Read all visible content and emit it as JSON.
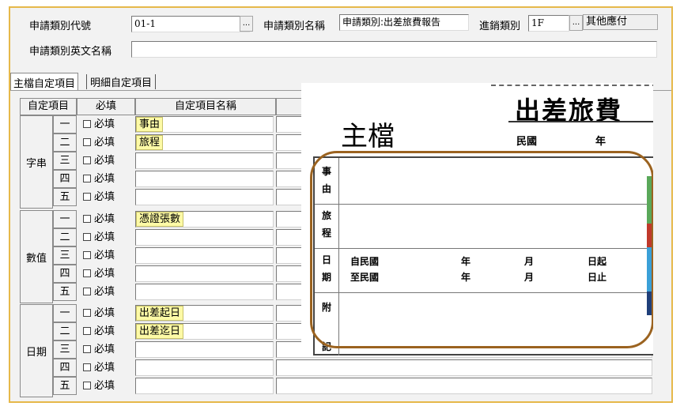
{
  "header": {
    "type_code_label": "申請類別代號",
    "type_code_value": "01-1",
    "ellipsis": "...",
    "type_name_label": "申請類別名稱",
    "type_name_value": "申請類別:出差旅費報告",
    "sales_type_label": "進銷類別",
    "sales_type_value": "1F",
    "sales_type_name": "其他應付",
    "english_name_label": "申請類別英文名稱",
    "english_name_value": ""
  },
  "tabs": [
    {
      "label": "主檔自定項目",
      "active": true
    },
    {
      "label": "明細自定項目",
      "active": false
    }
  ],
  "grid": {
    "headers": [
      "自定項目",
      "必填",
      "自定項目名稱"
    ],
    "required_label": "必填",
    "groups": [
      {
        "label": "字串",
        "rows": [
          {
            "num": "一",
            "name": "事由"
          },
          {
            "num": "二",
            "name": "旅程"
          },
          {
            "num": "三",
            "name": ""
          },
          {
            "num": "四",
            "name": ""
          },
          {
            "num": "五",
            "name": ""
          }
        ]
      },
      {
        "label": "數值",
        "rows": [
          {
            "num": "一",
            "name": "憑證張數"
          },
          {
            "num": "二",
            "name": ""
          },
          {
            "num": "三",
            "name": ""
          },
          {
            "num": "四",
            "name": ""
          },
          {
            "num": "五",
            "name": ""
          }
        ]
      },
      {
        "label": "日期",
        "rows": [
          {
            "num": "一",
            "name": "出差起日"
          },
          {
            "num": "二",
            "name": "出差迄日"
          },
          {
            "num": "三",
            "name": ""
          },
          {
            "num": "四",
            "name": ""
          },
          {
            "num": "五",
            "name": ""
          }
        ]
      }
    ]
  },
  "overlay": {
    "main_label": "主檔",
    "form_title": "出差旅費",
    "year_prefix": "民國",
    "year_unit": "年",
    "field_labels": [
      [
        "事",
        "由"
      ],
      [
        "旅",
        "程"
      ],
      [
        "日",
        "期"
      ],
      [
        "附",
        "記"
      ]
    ],
    "date_from": [
      "自民國",
      "年",
      "月",
      "日起"
    ],
    "date_to": [
      "至民國",
      "年",
      "月",
      "日止"
    ],
    "accent_color": "#9b6320"
  }
}
